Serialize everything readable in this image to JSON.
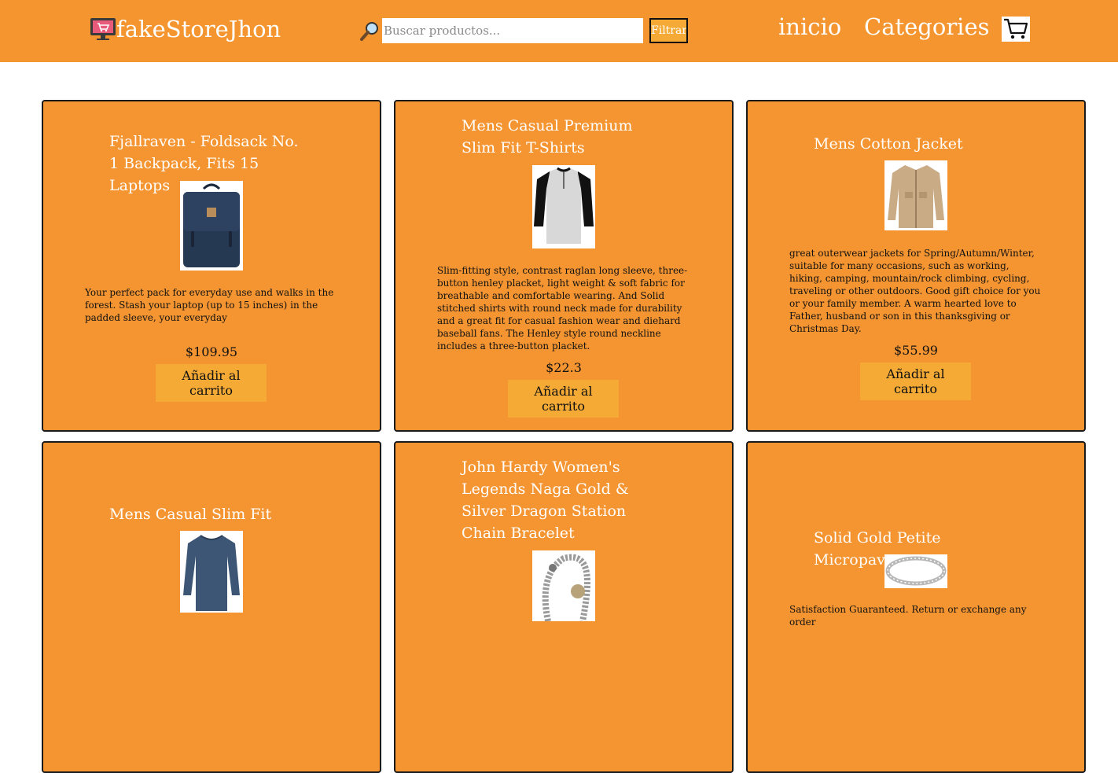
{
  "header": {
    "brand": "fakeStoreJhon",
    "search_placeholder": "Buscar productos...",
    "filter_label": "Filtrar",
    "nav": {
      "home": "inicio",
      "categories": "Categories"
    }
  },
  "colors": {
    "header_bg": "#f4952f",
    "card_bg": "#f49532",
    "button_bg": "#f4aa35"
  },
  "products": [
    {
      "title": "Fjallraven - Foldsack No. 1 Backpack, Fits 15 Laptops",
      "description": "Your perfect pack for everyday use and walks in the forest. Stash your laptop (up to 15 inches) in the padded sleeve, your everyday",
      "price": "$109.95",
      "button": "Añadir al carrito",
      "image": "backpack"
    },
    {
      "title": "Mens Casual Premium Slim Fit T-Shirts",
      "description": "Slim-fitting style, contrast raglan long sleeve, three-button henley placket, light weight & soft fabric for breathable and comfortable wearing. And Solid stitched shirts with round neck made for durability and a great fit for casual fashion wear and diehard baseball fans. The Henley style round neckline includes a three-button placket.",
      "price": "$22.3",
      "button": "Añadir al carrito",
      "image": "raglan-shirt"
    },
    {
      "title": "Mens Cotton Jacket",
      "description": "great outerwear jackets for Spring/Autumn/Winter, suitable for many occasions, such as working, hiking, camping, mountain/rock climbing, cycling, traveling or other outdoors. Good gift choice for you or your family member. A warm hearted love to Father, husband or son in this thanksgiving or Christmas Day.",
      "price": "$55.99",
      "button": "Añadir al carrito",
      "image": "jacket"
    },
    {
      "title": "Mens Casual Slim Fit",
      "image": "long-sleeve-shirt"
    },
    {
      "title": "John Hardy Women's Legends Naga Gold & Silver Dragon Station Chain Bracelet",
      "image": "bracelet"
    },
    {
      "title": "Solid Gold Petite Micropave",
      "description": "Satisfaction Guaranteed. Return or exchange any order",
      "image": "ring"
    }
  ]
}
